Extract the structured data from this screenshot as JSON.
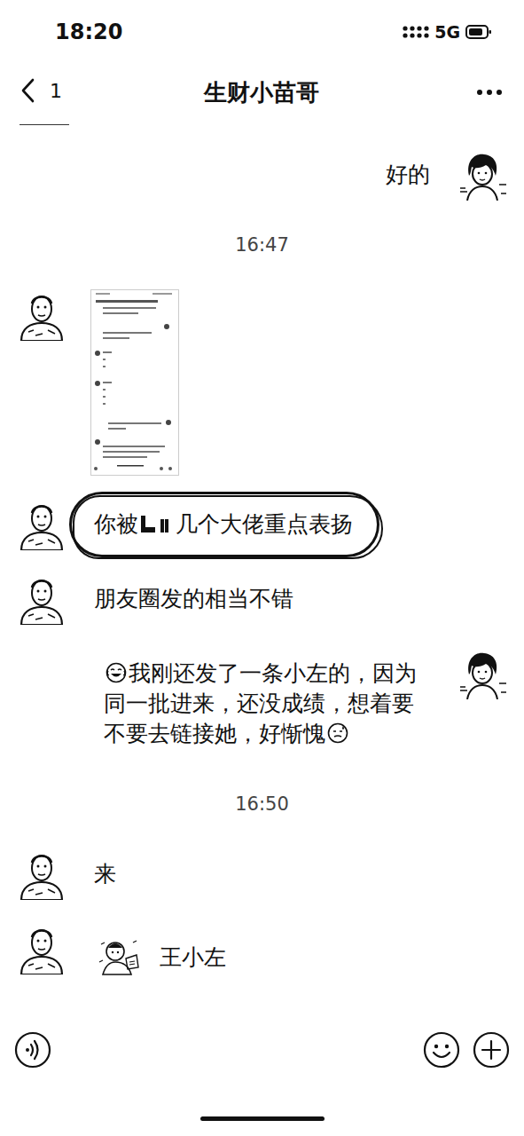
{
  "status_bar": {
    "time": "18:20",
    "network": "5G"
  },
  "nav": {
    "back_badge": "1",
    "title": "生财小苗哥"
  },
  "messages": [
    {
      "kind": "text",
      "from_me": true,
      "text": "好的",
      "emoji_before": false,
      "emoji_after": false,
      "circled": false
    },
    {
      "kind": "time",
      "text": "16:47"
    },
    {
      "kind": "image",
      "from_me": false,
      "circled": false
    },
    {
      "kind": "redacted",
      "from_me": false,
      "before": "你被",
      "after": "几个大佬重点表扬",
      "circled": true
    },
    {
      "kind": "text",
      "from_me": false,
      "text": "朋友圈发的相当不错",
      "emoji_before": false,
      "emoji_after": false,
      "circled": false
    },
    {
      "kind": "text",
      "from_me": true,
      "text": "我刚还发了一条小左的，因为同一批进来，还没成绩，想着要不要去链接她，好惭愧",
      "emoji_before": true,
      "emoji_after": true,
      "circled": false
    },
    {
      "kind": "time",
      "text": "16:50"
    },
    {
      "kind": "text",
      "from_me": false,
      "text": "来",
      "emoji_before": false,
      "emoji_after": false,
      "circled": false
    },
    {
      "kind": "contact",
      "from_me": false,
      "name": "王小左",
      "circled": false
    }
  ]
}
